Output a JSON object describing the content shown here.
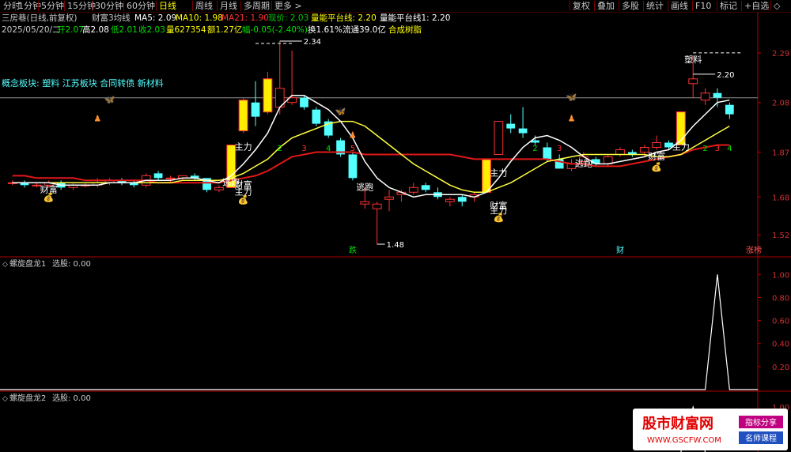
{
  "toolbar": {
    "left": [
      "分时",
      "1分钟",
      "5分钟",
      "15分钟",
      "30分钟",
      "60分钟",
      "日线",
      "周线",
      "月线",
      "多周期",
      "更多 >"
    ],
    "active_index": 6,
    "right": [
      "复权",
      "叠加",
      "多股",
      "统计",
      "画线",
      "F10",
      "标记",
      "+自选",
      "◇"
    ]
  },
  "header1": {
    "title": "三房巷(日线,前复权)",
    "indicator": "财富3均线",
    "ma5": "MA5: 2.09",
    "ma10": "MA10: 1.98",
    "ma21": "MA21: 1.90",
    "price": "现价: 2.03",
    "platform": "量能平台线: 2.20",
    "platform1": "量能平台线1: 2.20"
  },
  "header2": {
    "date": "2025/05/20/二",
    "open": "开2.07",
    "high": "高2.08",
    "low": "低2.01",
    "close": "收2.03",
    "volume": "量627354",
    "amount": "额1.27亿",
    "change": "幅-0.05(-2.40%)",
    "turnover": "换1.61%",
    "float": "流通39.0亿",
    "sector": "合成树脂"
  },
  "concept": "概念板块: 塑料 江苏板块 合同转债 新材料",
  "panel1": {
    "label": "螺旋盘龙1",
    "value": "选股: 0.00"
  },
  "panel2": {
    "label": "螺旋盘龙2",
    "value": "选股: 0.00"
  },
  "watermark": {
    "title": "股市财富网",
    "url": "WWW.GSCFW.COM",
    "tag1": "指标分享",
    "tag2": "名师课程"
  },
  "colors": {
    "up": "#ff3232",
    "down": "#54ffff",
    "ma5": "#ffffff",
    "ma10": "#ffff40",
    "ma21": "#e01818",
    "header_green": "#00dd00",
    "header_yellow": "#ffff00",
    "header_red": "#ff3030"
  },
  "chart_data": [
    {
      "type": "candlestick",
      "yaxis_ticks": [
        2.29,
        2.08,
        1.87,
        1.68,
        1.52
      ],
      "ylim": [
        1.45,
        2.36
      ],
      "hline": 2.1,
      "candles": [
        {
          "o": 1.74,
          "h": 1.75,
          "l": 1.73,
          "c": 1.74
        },
        {
          "o": 1.74,
          "h": 1.75,
          "l": 1.72,
          "c": 1.73
        },
        {
          "o": 1.73,
          "h": 1.74,
          "l": 1.72,
          "c": 1.73
        },
        {
          "o": 1.73,
          "h": 1.75,
          "l": 1.72,
          "c": 1.74
        },
        {
          "o": 1.74,
          "h": 1.75,
          "l": 1.71,
          "c": 1.72
        },
        {
          "o": 1.72,
          "h": 1.74,
          "l": 1.71,
          "c": 1.73
        },
        {
          "o": 1.73,
          "h": 1.74,
          "l": 1.72,
          "c": 1.73
        },
        {
          "o": 1.73,
          "h": 1.76,
          "l": 1.72,
          "c": 1.74
        },
        {
          "o": 1.74,
          "h": 1.76,
          "l": 1.73,
          "c": 1.75
        },
        {
          "o": 1.75,
          "h": 1.76,
          "l": 1.73,
          "c": 1.74
        },
        {
          "o": 1.74,
          "h": 1.75,
          "l": 1.72,
          "c": 1.73
        },
        {
          "o": 1.73,
          "h": 1.78,
          "l": 1.72,
          "c": 1.77
        },
        {
          "o": 1.78,
          "h": 1.79,
          "l": 1.75,
          "c": 1.76
        },
        {
          "o": 1.76,
          "h": 1.77,
          "l": 1.74,
          "c": 1.76
        },
        {
          "o": 1.76,
          "h": 1.77,
          "l": 1.75,
          "c": 1.77
        },
        {
          "o": 1.77,
          "h": 1.78,
          "l": 1.75,
          "c": 1.76
        },
        {
          "o": 1.76,
          "h": 1.76,
          "l": 1.7,
          "c": 1.71
        },
        {
          "o": 1.71,
          "h": 1.73,
          "l": 1.7,
          "c": 1.72
        },
        {
          "o": 1.72,
          "h": 1.9,
          "l": 1.72,
          "c": 1.9
        },
        {
          "o": 1.96,
          "h": 2.1,
          "l": 1.95,
          "c": 2.09
        },
        {
          "o": 2.08,
          "h": 2.17,
          "l": 1.98,
          "c": 2.02
        },
        {
          "o": 2.04,
          "h": 2.21,
          "l": 2.03,
          "c": 2.18
        },
        {
          "o": 2.06,
          "h": 2.34,
          "l": 2.03,
          "c": 2.14
        },
        {
          "o": 2.08,
          "h": 2.3,
          "l": 2.07,
          "c": 2.1
        },
        {
          "o": 2.1,
          "h": 2.11,
          "l": 2.05,
          "c": 2.06
        },
        {
          "o": 2.05,
          "h": 2.06,
          "l": 1.98,
          "c": 1.99
        },
        {
          "o": 2.0,
          "h": 2.01,
          "l": 1.93,
          "c": 1.94
        },
        {
          "o": 1.92,
          "h": 1.93,
          "l": 1.85,
          "c": 1.86
        },
        {
          "o": 1.86,
          "h": 1.87,
          "l": 1.75,
          "c": 1.76
        },
        {
          "o": 1.65,
          "h": 1.72,
          "l": 1.63,
          "c": 1.66
        },
        {
          "o": 1.63,
          "h": 1.66,
          "l": 1.48,
          "c": 1.65
        },
        {
          "o": 1.67,
          "h": 1.71,
          "l": 1.62,
          "c": 1.68
        },
        {
          "o": 1.69,
          "h": 1.71,
          "l": 1.66,
          "c": 1.7
        },
        {
          "o": 1.7,
          "h": 1.74,
          "l": 1.69,
          "c": 1.72
        },
        {
          "o": 1.73,
          "h": 1.74,
          "l": 1.7,
          "c": 1.71
        },
        {
          "o": 1.7,
          "h": 1.72,
          "l": 1.67,
          "c": 1.68
        },
        {
          "o": 1.66,
          "h": 1.68,
          "l": 1.64,
          "c": 1.67
        },
        {
          "o": 1.68,
          "h": 1.69,
          "l": 1.64,
          "c": 1.66
        },
        {
          "o": 1.68,
          "h": 1.7,
          "l": 1.66,
          "c": 1.69
        },
        {
          "o": 1.7,
          "h": 1.84,
          "l": 1.7,
          "c": 1.84
        },
        {
          "o": 1.86,
          "h": 2.0,
          "l": 1.86,
          "c": 2.0
        },
        {
          "o": 1.99,
          "h": 2.03,
          "l": 1.95,
          "c": 1.97
        },
        {
          "o": 1.97,
          "h": 2.06,
          "l": 1.93,
          "c": 1.95
        },
        {
          "o": 1.92,
          "h": 1.94,
          "l": 1.9,
          "c": 1.91
        },
        {
          "o": 1.89,
          "h": 1.91,
          "l": 1.83,
          "c": 1.84
        },
        {
          "o": 1.84,
          "h": 1.86,
          "l": 1.8,
          "c": 1.8
        },
        {
          "o": 1.8,
          "h": 1.84,
          "l": 1.79,
          "c": 1.82
        },
        {
          "o": 1.83,
          "h": 1.87,
          "l": 1.82,
          "c": 1.85
        },
        {
          "o": 1.84,
          "h": 1.85,
          "l": 1.81,
          "c": 1.82
        },
        {
          "o": 1.82,
          "h": 1.86,
          "l": 1.81,
          "c": 1.85
        },
        {
          "o": 1.86,
          "h": 1.89,
          "l": 1.85,
          "c": 1.88
        },
        {
          "o": 1.87,
          "h": 1.88,
          "l": 1.85,
          "c": 1.86
        },
        {
          "o": 1.87,
          "h": 1.9,
          "l": 1.85,
          "c": 1.89
        },
        {
          "o": 1.89,
          "h": 1.94,
          "l": 1.88,
          "c": 1.91
        },
        {
          "o": 1.91,
          "h": 1.92,
          "l": 1.88,
          "c": 1.89
        },
        {
          "o": 1.9,
          "h": 2.04,
          "l": 1.9,
          "c": 2.04
        },
        {
          "o": 2.16,
          "h": 2.28,
          "l": 2.1,
          "c": 2.18
        },
        {
          "o": 2.09,
          "h": 2.14,
          "l": 2.07,
          "c": 2.12
        },
        {
          "o": 2.12,
          "h": 2.14,
          "l": 2.06,
          "c": 2.1
        },
        {
          "o": 2.07,
          "h": 2.08,
          "l": 2.01,
          "c": 2.03
        }
      ],
      "ma5": [
        1.74,
        1.74,
        1.74,
        1.74,
        1.73,
        1.73,
        1.73,
        1.73,
        1.74,
        1.74,
        1.74,
        1.75,
        1.75,
        1.75,
        1.76,
        1.76,
        1.75,
        1.74,
        1.77,
        1.82,
        1.88,
        1.95,
        2.06,
        2.11,
        2.11,
        2.08,
        2.05,
        2.0,
        1.93,
        1.83,
        1.76,
        1.72,
        1.7,
        1.68,
        1.69,
        1.69,
        1.69,
        1.69,
        1.68,
        1.7,
        1.76,
        1.83,
        1.89,
        1.93,
        1.94,
        1.92,
        1.89,
        1.85,
        1.82,
        1.82,
        1.83,
        1.84,
        1.85,
        1.87,
        1.88,
        1.92,
        1.98,
        2.03,
        2.08,
        2.09
      ],
      "ma10": [
        1.74,
        1.74,
        1.74,
        1.74,
        1.74,
        1.74,
        1.74,
        1.74,
        1.74,
        1.74,
        1.74,
        1.74,
        1.74,
        1.74,
        1.75,
        1.75,
        1.75,
        1.75,
        1.76,
        1.78,
        1.81,
        1.84,
        1.89,
        1.93,
        1.95,
        1.97,
        1.99,
        2.0,
        2.0,
        1.98,
        1.94,
        1.9,
        1.86,
        1.82,
        1.79,
        1.76,
        1.73,
        1.71,
        1.7,
        1.7,
        1.72,
        1.74,
        1.77,
        1.8,
        1.83,
        1.84,
        1.85,
        1.86,
        1.86,
        1.86,
        1.86,
        1.86,
        1.86,
        1.85,
        1.85,
        1.86,
        1.89,
        1.92,
        1.95,
        1.98
      ],
      "ma21": [
        1.77,
        1.77,
        1.76,
        1.76,
        1.76,
        1.76,
        1.75,
        1.75,
        1.75,
        1.75,
        1.75,
        1.75,
        1.74,
        1.74,
        1.74,
        1.74,
        1.74,
        1.74,
        1.75,
        1.76,
        1.77,
        1.79,
        1.82,
        1.85,
        1.86,
        1.87,
        1.87,
        1.87,
        1.87,
        1.86,
        1.86,
        1.86,
        1.86,
        1.86,
        1.86,
        1.86,
        1.86,
        1.85,
        1.84,
        1.84,
        1.84,
        1.84,
        1.84,
        1.84,
        1.84,
        1.83,
        1.82,
        1.82,
        1.81,
        1.81,
        1.81,
        1.82,
        1.83,
        1.84,
        1.85,
        1.86,
        1.88,
        1.89,
        1.9,
        1.9
      ],
      "annotations": [
        {
          "i": 22,
          "price": 2.34,
          "text": "2.34",
          "kind": "high"
        },
        {
          "i": 30,
          "price": 1.48,
          "text": "1.48",
          "kind": "low"
        },
        {
          "i": 56,
          "price": 2.2,
          "text": "2.20",
          "kind": "high"
        },
        {
          "i": 56,
          "price": 2.25,
          "text": "塑料",
          "kind": "label"
        },
        {
          "i": 3,
          "price": 1.7,
          "text": "财富",
          "kind": "label"
        },
        {
          "i": 18,
          "price": 1.73,
          "text": "逃跑",
          "kind": "label"
        },
        {
          "i": 19,
          "price": 1.72,
          "text": "财富",
          "kind": "label"
        },
        {
          "i": 19,
          "price": 1.69,
          "text": "主力",
          "kind": "label"
        },
        {
          "i": 19,
          "price": 1.88,
          "text": "主力",
          "kind": "label"
        },
        {
          "i": 29,
          "price": 1.71,
          "text": "逃跑",
          "kind": "label"
        },
        {
          "i": 40,
          "price": 1.63,
          "text": "财富",
          "kind": "label"
        },
        {
          "i": 40,
          "price": 1.61,
          "text": "主力",
          "kind": "label"
        },
        {
          "i": 40,
          "price": 1.77,
          "text": "主力",
          "kind": "label"
        },
        {
          "i": 47,
          "price": 1.81,
          "text": "逃跑",
          "kind": "label"
        },
        {
          "i": 53,
          "price": 1.84,
          "text": "财富",
          "kind": "label"
        },
        {
          "i": 55,
          "price": 1.88,
          "text": "主力",
          "kind": "label"
        }
      ],
      "counters": [
        {
          "i": 22,
          "n": "2"
        },
        {
          "i": 24,
          "n": "3"
        },
        {
          "i": 26,
          "n": "4"
        },
        {
          "i": 28,
          "n": "5"
        },
        {
          "i": 43,
          "n": "2"
        },
        {
          "i": 45,
          "n": "3"
        },
        {
          "i": 57,
          "n": "2"
        },
        {
          "i": 58,
          "n": "3"
        },
        {
          "i": 59,
          "n": "4"
        }
      ],
      "bottom_labels": [
        {
          "i": 28,
          "text": "跌",
          "color": "#00dd00"
        },
        {
          "i": 50,
          "text": "财",
          "color": "#54ffff"
        },
        {
          "i": 61,
          "text": "涨榜",
          "color": "#ff5050"
        }
      ]
    },
    {
      "type": "line",
      "title": "螺旋盘龙1",
      "yaxis_ticks": [
        1.0,
        0.8,
        0.6,
        0.4,
        0.2
      ],
      "ylim": [
        0,
        1.05
      ],
      "spike_at": 58,
      "values_note": "zero everywhere except a single spike of 1.00"
    },
    {
      "type": "line",
      "title": "螺旋盘龙2",
      "yaxis_ticks": [
        1.0
      ],
      "spike_at": 56
    }
  ]
}
